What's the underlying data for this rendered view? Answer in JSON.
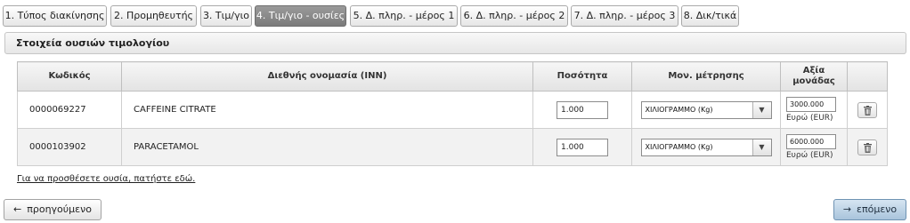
{
  "tabs": [
    {
      "label": "1. Τύπος διακίνησης"
    },
    {
      "label": "2. Προμηθευτής"
    },
    {
      "label": "3. Τιμ/γιο"
    },
    {
      "label": "4. Τιμ/γιο - ουσίες",
      "active": true
    },
    {
      "label": "5. Δ. πληρ. - μέρος 1"
    },
    {
      "label": "6. Δ. πληρ. - μέρος 2"
    },
    {
      "label": "7. Δ. πληρ. - μέρος 3"
    },
    {
      "label": "8. Δικ/τικά"
    }
  ],
  "panel": {
    "title": "Στοιχεία ουσιών τιμολογίου"
  },
  "table": {
    "headers": {
      "code": "Κωδικός",
      "inn": "Διεθνής ονομασία (INN)",
      "quantity": "Ποσότητα",
      "uom": "Μον. μέτρησης",
      "unit_value_line1": "Αξία",
      "unit_value_line2": "μονάδας"
    },
    "rows": [
      {
        "code": "0000069227",
        "inn": "CAFFEINE CITRATE",
        "quantity": "1.000",
        "uom": "ΧΙΛΙΟΓΡΑΜΜΟ (Kg)",
        "unit_value": "3000.000",
        "currency": "Ευρώ (EUR)"
      },
      {
        "code": "0000103902",
        "inn": "PARACETAMOL",
        "quantity": "1.000",
        "uom": "ΧΙΛΙΟΓΡΑΜΜΟ (Kg)",
        "unit_value": "6000.000",
        "currency": "Ευρώ (EUR)"
      }
    ]
  },
  "add_link": "Για να προσθέσετε ουσία, πατήστε εδώ.",
  "nav": {
    "prev_icon": "←",
    "prev_label": "προηγούμενο",
    "next_icon": "→",
    "next_label": "επόμενο"
  },
  "icons": {
    "delete": "trash-icon",
    "dropdown": "chevron-down-icon"
  },
  "colors": {
    "active_tab": "#8a8a8a",
    "next_button": "#b9d0e4"
  }
}
